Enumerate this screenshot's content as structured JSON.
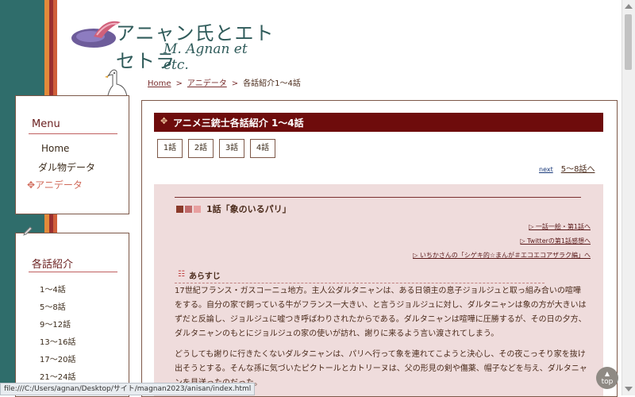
{
  "header": {
    "logo_jp": "アニャン氏とエトセトラ",
    "logo_en": "M. Agnan et etc."
  },
  "breadcrumb": {
    "home": "Home",
    "section": "アニデータ",
    "current": "各話紹介1〜4話",
    "sep": ">"
  },
  "menu": {
    "title": "Menu",
    "items": [
      {
        "label": "Home"
      },
      {
        "label": "ダル物データ"
      },
      {
        "label": "アニデータ"
      }
    ]
  },
  "episodes_nav": {
    "title": "各話紹介",
    "items": [
      "1〜4話",
      "5〜8話",
      "9〜12話",
      "13〜16話",
      "17〜20話",
      "21〜24話"
    ]
  },
  "main": {
    "title": "アニメ三銃士各話紹介 1〜4話",
    "episode_buttons": [
      "1話",
      "2話",
      "3話",
      "4話"
    ],
    "next": {
      "tag": "next",
      "label": "5〜8話へ"
    },
    "episode": {
      "title": "1話「象のいるパリ」",
      "links": [
        "▷ 一話一絵・第1話へ",
        "▷ Twitterの第1話感想へ",
        "▷ いちかさんの「シゲキ的☆まんが＃エコエコアザラク編」へ"
      ],
      "synopsis_title": "あらすじ",
      "paragraphs": [
        "17世紀フランス・ガスコーニュ地方。主人公ダルタニャンは、ある日領主の息子ジョルジュと取っ組み合いの喧嘩をする。自分の家で飼っている牛がフランス一大きい、と言うジョルジュに対し、ダルタニャンは象の方が大きいはずだと反論し、ジョルジュに嘘つき呼ばわりされたからである。ダルタニャンは喧嘩に圧勝するが、その日の夕方、ダルタニャンのもとにジョルジュの家の使いが訪れ、謝りに来るよう言い渡されてしまう。",
        "どうしても謝りに行きたくないダルタニャンは、パリへ行って象を連れてこようと決心し、その夜こっそり家を抜け出そうとする。そんな孫に気づいたピクトールとカトリーヌは、父の形見の剣や傷薬、帽子などを与え、ダルタニャンを見送ったのだった。"
      ]
    }
  },
  "status_url": "file:///C:/Users/agnan/Desktop/サイト/magnan2023/anisan/index.html",
  "top_button": "top",
  "colors": {
    "teal": "#2f6d6b",
    "maroon": "#6e0c0c",
    "pink": "#efdcdc",
    "accent": "#d06a5a"
  }
}
